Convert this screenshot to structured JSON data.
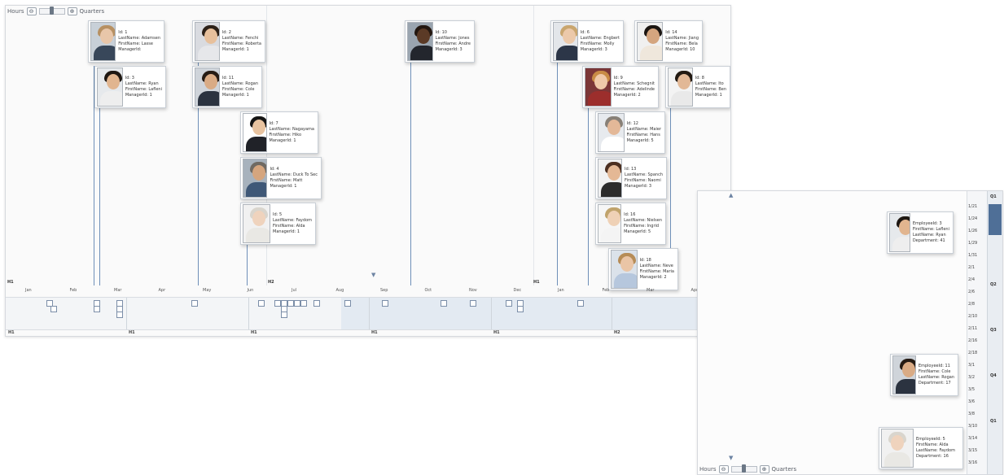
{
  "toolbar": {
    "left_label": "Hours",
    "right_label": "Quarters",
    "zoom_out": "⊖",
    "zoom_in": "⊕"
  },
  "main": {
    "cards": [
      {
        "id": "Id: 1",
        "l1": "LastName: Adamsen",
        "l2": "FirstName: Lasse",
        "l3": "ManagerId:",
        "skin": "#e8c6a9",
        "hair": "#b79062",
        "shirt": "#38475a",
        "bg": "#c8d0d8"
      },
      {
        "id": "Id: 2",
        "l1": "LastName: Fenchi",
        "l2": "FirstName: Roberta",
        "l3": "ManagerId: 1",
        "skin": "#e7c09c",
        "hair": "#2c2118",
        "shirt": "#e6e7ea",
        "bg": "#d9dbe0"
      },
      {
        "id": "Id: 3",
        "l1": "LastName: Ryan",
        "l2": "FirstName: Lafleni",
        "l3": "ManagerId: 1",
        "skin": "#e1b58f",
        "hair": "#1e1712",
        "shirt": "#eeeeee",
        "bg": "#e6e9ec"
      },
      {
        "id": "Id: 11",
        "l1": "LastName: Rogan",
        "l2": "FirstName: Cole",
        "l3": "ManagerId: 1",
        "skin": "#d9ab85",
        "hair": "#251b14",
        "shirt": "#2b3340",
        "bg": "#cfd4da"
      },
      {
        "id": "Id: 7",
        "l1": "LastName: Nagayama",
        "l2": "FirstName: Hiko",
        "l3": "ManagerId: 1",
        "skin": "#e8c3a0",
        "hair": "#141414",
        "shirt": "#202228",
        "bg": "#ffffff"
      },
      {
        "id": "Id: 4",
        "l1": "LastName: Duck To Sec",
        "l2": "FirstName: Matt",
        "l3": "ManagerId: 1",
        "skin": "#d5a57e",
        "hair": "#6f6a63",
        "shirt": "#3f5877",
        "bg": "#a7b2bd"
      },
      {
        "id": "Id: 5",
        "l1": "LastName: Faydom",
        "l2": "FirstName: Alda",
        "l3": "ManagerId: 1",
        "skin": "#efd3bd",
        "hair": "#d9d5cd",
        "shirt": "#e9e8e4",
        "bg": "#f1f1f1"
      },
      {
        "id": "Id: 10",
        "l1": "LastName: Jones",
        "l2": "FirstName: Andre",
        "l3": "ManagerId: 3",
        "skin": "#5b3a26",
        "hair": "#231710",
        "shirt": "#23262d",
        "bg": "#9aa5b0"
      },
      {
        "id": "Id: 6",
        "l1": "LastName: Engbert",
        "l2": "FirstName: Molly",
        "l3": "ManagerId: 3",
        "skin": "#ecc9aa",
        "hair": "#c9a66f",
        "shirt": "#2c3648",
        "bg": "#e3e6ea"
      },
      {
        "id": "Id: 14",
        "l1": "LastName: Jiang",
        "l2": "FirstName: Bela",
        "l3": "ManagerId: 10",
        "skin": "#d4a57f",
        "hair": "#1b1511",
        "shirt": "#efe7dc",
        "bg": "#f0f0f0"
      },
      {
        "id": "Id: 9",
        "l1": "LastName: Schegnit",
        "l2": "FirstName: Adelinde",
        "l3": "ManagerId: 2",
        "skin": "#efc9a9",
        "hair": "#c88b45",
        "shirt": "#9c2e2c",
        "bg": "#7b3637"
      },
      {
        "id": "Id: 8",
        "l1": "LastName: Ito",
        "l2": "FirstName: Ben",
        "l3": "ManagerId: 1",
        "skin": "#e2b896",
        "hair": "#221912",
        "shirt": "#e9e9e9",
        "bg": "#f3f3f3"
      },
      {
        "id": "Id: 12",
        "l1": "LastName: Maier",
        "l2": "FirstName: Hans",
        "l3": "ManagerId: 5",
        "skin": "#e3b898",
        "hair": "#888077",
        "shirt": "#ffffff",
        "bg": "#e7eaee"
      },
      {
        "id": "Id: 13",
        "l1": "LastName: Spanch",
        "l2": "FirstName: Naomi",
        "l3": "ManagerId: 3",
        "skin": "#e4b895",
        "hair": "#4c2f20",
        "shirt": "#2c2c2c",
        "bg": "#f1f1f1"
      },
      {
        "id": "Id: 16",
        "l1": "LastName: Nielsen",
        "l2": "FirstName: Ingrid",
        "l3": "ManagerId: 5",
        "skin": "#efd1b6",
        "hair": "#c0a36c",
        "shirt": "#f4f4f4",
        "bg": "#f6f6f6"
      },
      {
        "id": "Id: 18",
        "l1": "LastName: Neve",
        "l2": "FirstName: Maria",
        "l3": "ManagerId: 2",
        "skin": "#eac5a6",
        "hair": "#b68c57",
        "shirt": "#b6c7dd",
        "bg": "#dbe2ea"
      }
    ],
    "axis_months": [
      "Jan",
      "Feb",
      "Mar",
      "Apr",
      "May",
      "Jun",
      "Jul",
      "Aug",
      "Sep",
      "Oct",
      "Nov",
      "Dec",
      "Jan",
      "Feb",
      "Mar",
      "Apr"
    ],
    "years": [
      "H1",
      "H2",
      "H1"
    ],
    "quarters": [
      "H1",
      "H1",
      "H1",
      "H1",
      "H1",
      "H2"
    ]
  },
  "vertical": {
    "ticks": [
      "1/21",
      "1/24",
      "1/26",
      "1/29",
      "1/31",
      "2/1",
      "2/4",
      "2/6",
      "2/8",
      "2/10",
      "2/11",
      "2/16",
      "2/18",
      "3/1",
      "3/2",
      "3/5",
      "3/6",
      "3/8",
      "3/10",
      "3/14",
      "3/15",
      "3/16"
    ],
    "quarters": [
      "Q1",
      "Q2",
      "Q3",
      "Q4",
      "Q1"
    ],
    "cards": [
      {
        "l1": "EmployeeId: 3",
        "l2": "FirstName: Lafleni",
        "l3": "LastName: Ryan",
        "l4": "Department: 41",
        "skin": "#e1b58f",
        "hair": "#1e1712",
        "shirt": "#eeeeee",
        "bg": "#e6e9ec"
      },
      {
        "l1": "EmployeeId: 11",
        "l2": "FirstName: Cole",
        "l3": "LastName: Rogan",
        "l4": "Department: 17",
        "skin": "#d9ab85",
        "hair": "#251b14",
        "shirt": "#2b3340",
        "bg": "#cfd4da"
      },
      {
        "l1": "EmployeeId: 5",
        "l2": "FirstName: Alda",
        "l3": "LastName: Faydom",
        "l4": "Department: 16",
        "skin": "#efd3bd",
        "hair": "#d9d5cd",
        "shirt": "#e9e8e4",
        "bg": "#f1f1f1"
      }
    ]
  }
}
